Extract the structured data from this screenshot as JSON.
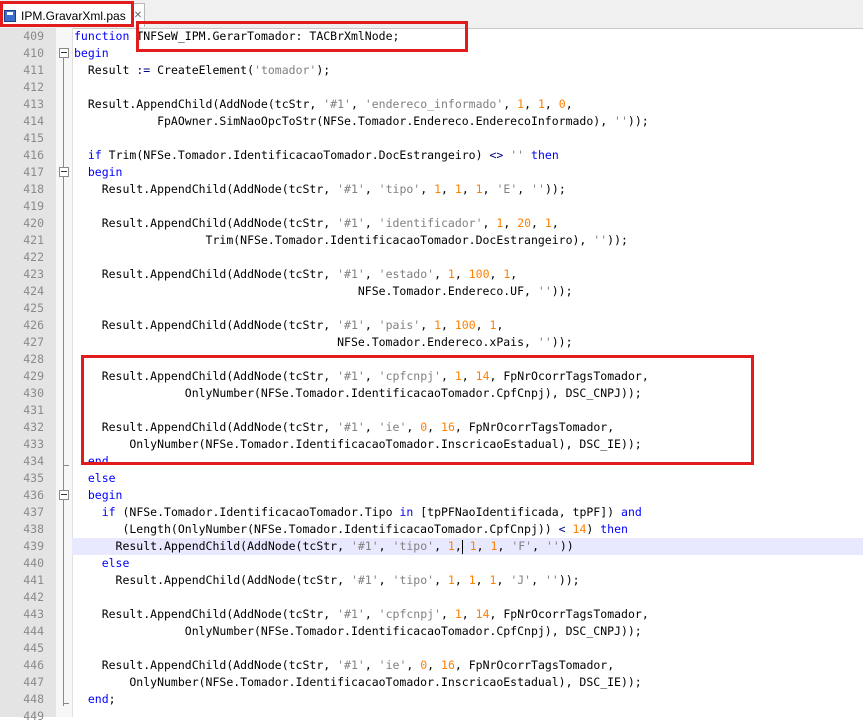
{
  "tab": {
    "filename": "IPM.GravarXml.pas"
  },
  "line_numbers": [
    "409",
    "410",
    "411",
    "412",
    "413",
    "414",
    "415",
    "416",
    "417",
    "418",
    "419",
    "420",
    "421",
    "422",
    "423",
    "424",
    "425",
    "426",
    "427",
    "428",
    "429",
    "430",
    "431",
    "432",
    "433",
    "434",
    "435",
    "436",
    "437",
    "438",
    "439",
    "440",
    "441",
    "442",
    "443",
    "444",
    "445",
    "446",
    "447",
    "448",
    "449"
  ],
  "code_lines": [
    [
      {
        "t": "kw",
        "v": "function"
      },
      {
        "t": "n",
        "v": " TNFSeW_IPM.GerarTomador: TACBrXmlNode;"
      }
    ],
    [
      {
        "t": "kw",
        "v": "begin"
      }
    ],
    [
      {
        "t": "n",
        "v": "  Result "
      },
      {
        "t": "op",
        "v": ":="
      },
      {
        "t": "n",
        "v": " CreateElement("
      },
      {
        "t": "str",
        "v": "'tomador'"
      },
      {
        "t": "n",
        "v": ");"
      }
    ],
    [],
    [
      {
        "t": "n",
        "v": "  Result.AppendChild(AddNode(tcStr, "
      },
      {
        "t": "str",
        "v": "'#1'"
      },
      {
        "t": "n",
        "v": ", "
      },
      {
        "t": "str",
        "v": "'endereco_informado'"
      },
      {
        "t": "n",
        "v": ", "
      },
      {
        "t": "num",
        "v": "1"
      },
      {
        "t": "n",
        "v": ", "
      },
      {
        "t": "num",
        "v": "1"
      },
      {
        "t": "n",
        "v": ", "
      },
      {
        "t": "num",
        "v": "0"
      },
      {
        "t": "n",
        "v": ","
      }
    ],
    [
      {
        "t": "n",
        "v": "            FpAOwner.SimNaoOpcToStr(NFSe.Tomador.Endereco.EnderecoInformado), "
      },
      {
        "t": "str",
        "v": "''"
      },
      {
        "t": "n",
        "v": "));"
      }
    ],
    [],
    [
      {
        "t": "n",
        "v": "  "
      },
      {
        "t": "kw",
        "v": "if"
      },
      {
        "t": "n",
        "v": " Trim(NFSe.Tomador.IdentificacaoTomador.DocEstrangeiro) "
      },
      {
        "t": "op",
        "v": "<>"
      },
      {
        "t": "n",
        "v": " "
      },
      {
        "t": "str",
        "v": "''"
      },
      {
        "t": "n",
        "v": " "
      },
      {
        "t": "kw",
        "v": "then"
      }
    ],
    [
      {
        "t": "n",
        "v": "  "
      },
      {
        "t": "kw",
        "v": "begin"
      }
    ],
    [
      {
        "t": "n",
        "v": "    Result.AppendChild(AddNode(tcStr, "
      },
      {
        "t": "str",
        "v": "'#1'"
      },
      {
        "t": "n",
        "v": ", "
      },
      {
        "t": "str",
        "v": "'tipo'"
      },
      {
        "t": "n",
        "v": ", "
      },
      {
        "t": "num",
        "v": "1"
      },
      {
        "t": "n",
        "v": ", "
      },
      {
        "t": "num",
        "v": "1"
      },
      {
        "t": "n",
        "v": ", "
      },
      {
        "t": "num",
        "v": "1"
      },
      {
        "t": "n",
        "v": ", "
      },
      {
        "t": "str",
        "v": "'E'"
      },
      {
        "t": "n",
        "v": ", "
      },
      {
        "t": "str",
        "v": "''"
      },
      {
        "t": "n",
        "v": "));"
      }
    ],
    [],
    [
      {
        "t": "n",
        "v": "    Result.AppendChild(AddNode(tcStr, "
      },
      {
        "t": "str",
        "v": "'#1'"
      },
      {
        "t": "n",
        "v": ", "
      },
      {
        "t": "str",
        "v": "'identificador'"
      },
      {
        "t": "n",
        "v": ", "
      },
      {
        "t": "num",
        "v": "1"
      },
      {
        "t": "n",
        "v": ", "
      },
      {
        "t": "num",
        "v": "20"
      },
      {
        "t": "n",
        "v": ", "
      },
      {
        "t": "num",
        "v": "1"
      },
      {
        "t": "n",
        "v": ","
      }
    ],
    [
      {
        "t": "n",
        "v": "                   Trim(NFSe.Tomador.IdentificacaoTomador.DocEstrangeiro), "
      },
      {
        "t": "str",
        "v": "''"
      },
      {
        "t": "n",
        "v": "));"
      }
    ],
    [],
    [
      {
        "t": "n",
        "v": "    Result.AppendChild(AddNode(tcStr, "
      },
      {
        "t": "str",
        "v": "'#1'"
      },
      {
        "t": "n",
        "v": ", "
      },
      {
        "t": "str",
        "v": "'estado'"
      },
      {
        "t": "n",
        "v": ", "
      },
      {
        "t": "num",
        "v": "1"
      },
      {
        "t": "n",
        "v": ", "
      },
      {
        "t": "num",
        "v": "100"
      },
      {
        "t": "n",
        "v": ", "
      },
      {
        "t": "num",
        "v": "1"
      },
      {
        "t": "n",
        "v": ","
      }
    ],
    [
      {
        "t": "n",
        "v": "                                         NFSe.Tomador.Endereco.UF, "
      },
      {
        "t": "str",
        "v": "''"
      },
      {
        "t": "n",
        "v": "));"
      }
    ],
    [],
    [
      {
        "t": "n",
        "v": "    Result.AppendChild(AddNode(tcStr, "
      },
      {
        "t": "str",
        "v": "'#1'"
      },
      {
        "t": "n",
        "v": ", "
      },
      {
        "t": "str",
        "v": "'pais'"
      },
      {
        "t": "n",
        "v": ", "
      },
      {
        "t": "num",
        "v": "1"
      },
      {
        "t": "n",
        "v": ", "
      },
      {
        "t": "num",
        "v": "100"
      },
      {
        "t": "n",
        "v": ", "
      },
      {
        "t": "num",
        "v": "1"
      },
      {
        "t": "n",
        "v": ","
      }
    ],
    [
      {
        "t": "n",
        "v": "                                      NFSe.Tomador.Endereco.xPais, "
      },
      {
        "t": "str",
        "v": "''"
      },
      {
        "t": "n",
        "v": "));"
      }
    ],
    [],
    [
      {
        "t": "n",
        "v": "    Result.AppendChild(AddNode(tcStr, "
      },
      {
        "t": "str",
        "v": "'#1'"
      },
      {
        "t": "n",
        "v": ", "
      },
      {
        "t": "str",
        "v": "'cpfcnpj'"
      },
      {
        "t": "n",
        "v": ", "
      },
      {
        "t": "num",
        "v": "1"
      },
      {
        "t": "n",
        "v": ", "
      },
      {
        "t": "num",
        "v": "14"
      },
      {
        "t": "n",
        "v": ", FpNrOcorrTagsTomador,"
      }
    ],
    [
      {
        "t": "n",
        "v": "                OnlyNumber(NFSe.Tomador.IdentificacaoTomador.CpfCnpj), DSC_CNPJ));"
      }
    ],
    [],
    [
      {
        "t": "n",
        "v": "    Result.AppendChild(AddNode(tcStr, "
      },
      {
        "t": "str",
        "v": "'#1'"
      },
      {
        "t": "n",
        "v": ", "
      },
      {
        "t": "str",
        "v": "'ie'"
      },
      {
        "t": "n",
        "v": ", "
      },
      {
        "t": "num",
        "v": "0"
      },
      {
        "t": "n",
        "v": ", "
      },
      {
        "t": "num",
        "v": "16"
      },
      {
        "t": "n",
        "v": ", FpNrOcorrTagsTomador,"
      }
    ],
    [
      {
        "t": "n",
        "v": "        OnlyNumber(NFSe.Tomador.IdentificacaoTomador.InscricaoEstadual), DSC_IE));"
      }
    ],
    [
      {
        "t": "n",
        "v": "  "
      },
      {
        "t": "kw",
        "v": "end"
      }
    ],
    [
      {
        "t": "n",
        "v": "  "
      },
      {
        "t": "kw",
        "v": "else"
      }
    ],
    [
      {
        "t": "n",
        "v": "  "
      },
      {
        "t": "kw",
        "v": "begin"
      }
    ],
    [
      {
        "t": "n",
        "v": "    "
      },
      {
        "t": "kw",
        "v": "if"
      },
      {
        "t": "n",
        "v": " (NFSe.Tomador.IdentificacaoTomador.Tipo "
      },
      {
        "t": "kw",
        "v": "in"
      },
      {
        "t": "n",
        "v": " [tpPFNaoIdentificada, tpPF]) "
      },
      {
        "t": "kw",
        "v": "and"
      }
    ],
    [
      {
        "t": "n",
        "v": "       (Length(OnlyNumber(NFSe.Tomador.IdentificacaoTomador.CpfCnpj)) "
      },
      {
        "t": "op",
        "v": "<"
      },
      {
        "t": "n",
        "v": " "
      },
      {
        "t": "num",
        "v": "14"
      },
      {
        "t": "n",
        "v": ") "
      },
      {
        "t": "kw",
        "v": "then"
      }
    ],
    [
      {
        "t": "n",
        "v": "      Result.AppendChild(AddNode(tcStr, "
      },
      {
        "t": "str",
        "v": "'#1'"
      },
      {
        "t": "n",
        "v": ", "
      },
      {
        "t": "str",
        "v": "'tipo'"
      },
      {
        "t": "n",
        "v": ", "
      },
      {
        "t": "num",
        "v": "1"
      },
      {
        "t": "n",
        "v": ","
      },
      {
        "t": "cur",
        "v": ""
      },
      {
        "t": "n",
        "v": " "
      },
      {
        "t": "num",
        "v": "1"
      },
      {
        "t": "n",
        "v": ", "
      },
      {
        "t": "num",
        "v": "1"
      },
      {
        "t": "n",
        "v": ", "
      },
      {
        "t": "str",
        "v": "'F'"
      },
      {
        "t": "n",
        "v": ", "
      },
      {
        "t": "str",
        "v": "''"
      },
      {
        "t": "n",
        "v": "))"
      }
    ],
    [
      {
        "t": "n",
        "v": "    "
      },
      {
        "t": "kw",
        "v": "else"
      }
    ],
    [
      {
        "t": "n",
        "v": "      Result.AppendChild(AddNode(tcStr, "
      },
      {
        "t": "str",
        "v": "'#1'"
      },
      {
        "t": "n",
        "v": ", "
      },
      {
        "t": "str",
        "v": "'tipo'"
      },
      {
        "t": "n",
        "v": ", "
      },
      {
        "t": "num",
        "v": "1"
      },
      {
        "t": "n",
        "v": ", "
      },
      {
        "t": "num",
        "v": "1"
      },
      {
        "t": "n",
        "v": ", "
      },
      {
        "t": "num",
        "v": "1"
      },
      {
        "t": "n",
        "v": ", "
      },
      {
        "t": "str",
        "v": "'J'"
      },
      {
        "t": "n",
        "v": ", "
      },
      {
        "t": "str",
        "v": "''"
      },
      {
        "t": "n",
        "v": "));"
      }
    ],
    [],
    [
      {
        "t": "n",
        "v": "    Result.AppendChild(AddNode(tcStr, "
      },
      {
        "t": "str",
        "v": "'#1'"
      },
      {
        "t": "n",
        "v": ", "
      },
      {
        "t": "str",
        "v": "'cpfcnpj'"
      },
      {
        "t": "n",
        "v": ", "
      },
      {
        "t": "num",
        "v": "1"
      },
      {
        "t": "n",
        "v": ", "
      },
      {
        "t": "num",
        "v": "14"
      },
      {
        "t": "n",
        "v": ", FpNrOcorrTagsTomador,"
      }
    ],
    [
      {
        "t": "n",
        "v": "                OnlyNumber(NFSe.Tomador.IdentificacaoTomador.CpfCnpj), DSC_CNPJ));"
      }
    ],
    [],
    [
      {
        "t": "n",
        "v": "    Result.AppendChild(AddNode(tcStr, "
      },
      {
        "t": "str",
        "v": "'#1'"
      },
      {
        "t": "n",
        "v": ", "
      },
      {
        "t": "str",
        "v": "'ie'"
      },
      {
        "t": "n",
        "v": ", "
      },
      {
        "t": "num",
        "v": "0"
      },
      {
        "t": "n",
        "v": ", "
      },
      {
        "t": "num",
        "v": "16"
      },
      {
        "t": "n",
        "v": ", FpNrOcorrTagsTomador,"
      }
    ],
    [
      {
        "t": "n",
        "v": "        OnlyNumber(NFSe.Tomador.IdentificacaoTomador.InscricaoEstadual), DSC_IE));"
      }
    ],
    [
      {
        "t": "n",
        "v": "  "
      },
      {
        "t": "kw",
        "v": "end"
      },
      {
        "t": "n",
        "v": ";"
      }
    ],
    []
  ],
  "highlighted_line": "439",
  "colors": {
    "keyword": "#0000ff",
    "string": "#808080",
    "number": "#ff8000",
    "operator": "#000080",
    "annotation": "#e01c1c",
    "current_line": "#e8e8ff"
  }
}
